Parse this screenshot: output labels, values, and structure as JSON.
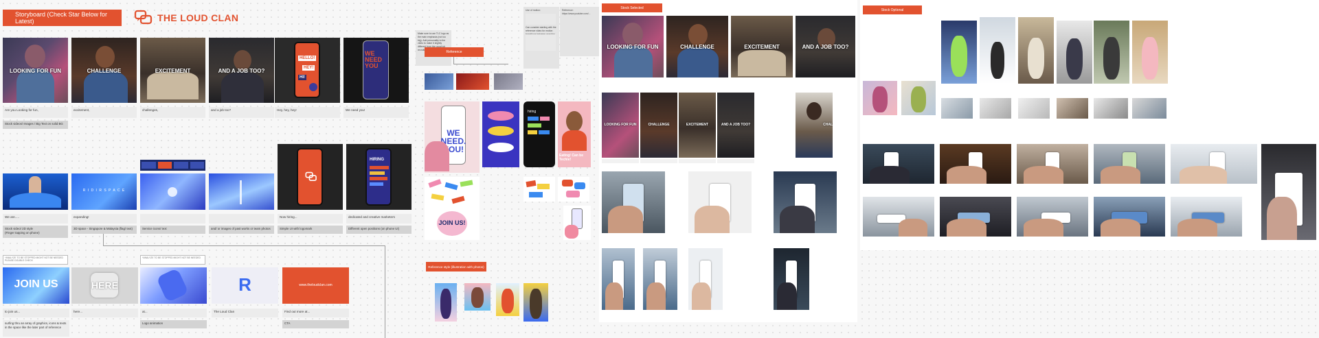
{
  "colors": {
    "accent": "#e2522f",
    "brand": "#e2522f"
  },
  "storyboard": {
    "title": "Storyboard (Check Star Below for Latest)",
    "brand": "THE LOUD CLAN",
    "logo_icon": "chat-bubbles-icon",
    "row1": [
      {
        "overlay": "LOOKING FOR FUN",
        "caption": "Are you Looking for fun,"
      },
      {
        "overlay": "CHALLENGE",
        "caption": "excitement,"
      },
      {
        "overlay": "EXCITEMENT",
        "caption": "challenges,"
      },
      {
        "overlay": "AND A JOB TOO?",
        "caption": "and a job too?"
      },
      {
        "overlay": "",
        "phone_lines": [
          "HELLO!",
          "HEY!",
          "HI!"
        ],
        "caption": "Hey, hey, hey!"
      },
      {
        "overlay": "",
        "phone_lines": [
          "WE",
          "NEED",
          "YOU"
        ],
        "caption": "We need you!"
      }
    ],
    "row1_note": "Stock videos/ Images / Big Text on solid BG",
    "row2": [
      {
        "caption": "We are.....",
        "note": "Stock video/ 2D style\n(Finger tapping on phone)"
      },
      {
        "caption": "expanding!",
        "screen_text": "R I D I R S P A C E",
        "note": "3D space - Singapore & Malaysia (flag/ text)"
      },
      {
        "caption": "",
        "note": "Service icons/ text"
      },
      {
        "caption": "",
        "note": "and/ or images of past works or team photos"
      },
      {
        "caption": "Now hiring...",
        "note": "Simple UI with logomark"
      },
      {
        "caption": "dedicated and creative marketers",
        "phone_title": "HIRING",
        "note": "Different open positions (on phone UI)"
      }
    ],
    "row3": [
      {
        "overlay": "JOIN US",
        "caption": "to join us...",
        "note": "surfing thru an array of graphics, icons & texts in the space like the later part of reference"
      },
      {
        "overlay": "HERE",
        "caption": "here..."
      },
      {
        "overlay": "",
        "caption": "at...",
        "note": "Logo animation"
      },
      {
        "overlay": "R",
        "caption": "The Loud Clan"
      },
      {
        "overlay": "www.theloudclan.com",
        "caption": "Find out more at...",
        "note": "CTA"
      }
    ],
    "row3_labels": [
      "*ANALYZE TO BE STOPPED MIGHT NOT BE NEEDED  PLEASE DOUBLE CHECK",
      "*ANALYZE TO BE STOPPED MIGHT NOT BE NEEDED"
    ]
  },
  "reference": {
    "label": "Reference",
    "style_label": "Reference style (illustration with photos)",
    "notes": [
      "Make sure to use TLC logo as the main emphasis (not too big). Add personality to the video to make it slightly different from the usual job recruitment ads.",
      "Use of motion:",
      "Use and apply similar animation style to the reference video",
      "Can consider starting with the reference video for motion transitions between graphics and typography...",
      "Reference: https://www.youtube.com/..."
    ],
    "poster_text": [
      "WE",
      "NEED.",
      "YOU!"
    ],
    "stack_text": "hiring",
    "sticker_text": "JOIN US!",
    "portrait_caption": "Eating! Can be Techie!"
  },
  "stock_selected": {
    "label": "Stock Selected",
    "row1": [
      "LOOKING FOR FUN",
      "CHALLENGE",
      "EXCITEMENT",
      "AND A JOB TOO?"
    ],
    "row2": [
      "LOOKING FOR FUN",
      "CHALLENGE",
      "EXCITEMENT",
      "AND A JOB TOO?",
      "CHAL"
    ]
  },
  "stock_optional": {
    "label": "Stock Optional"
  }
}
